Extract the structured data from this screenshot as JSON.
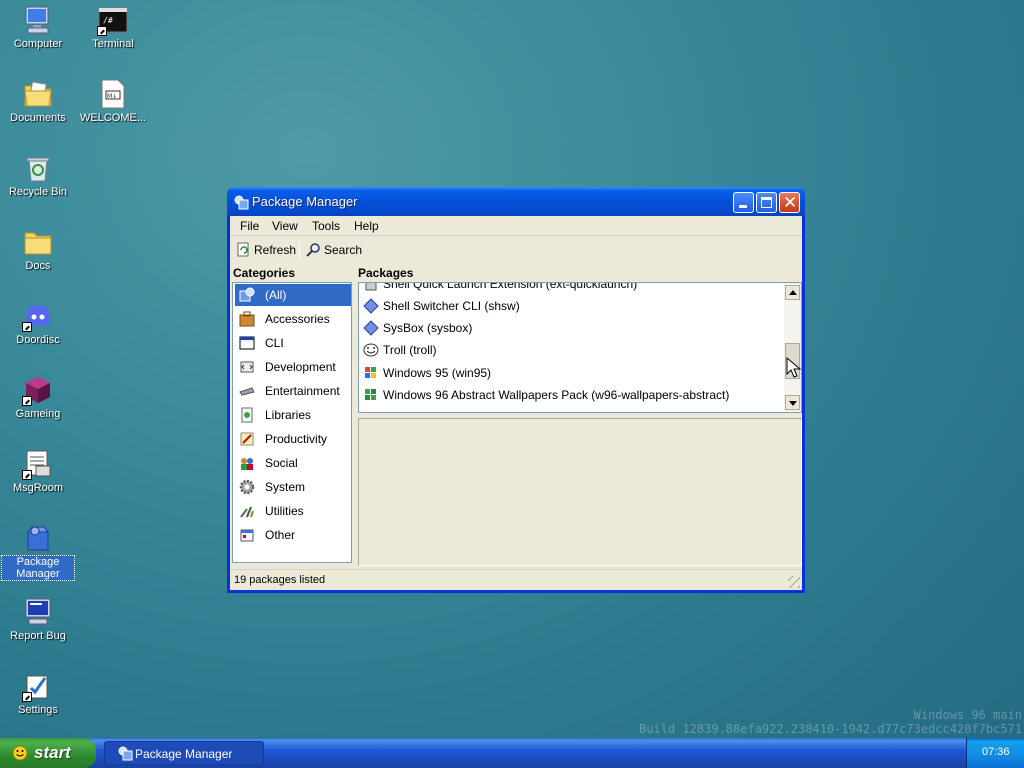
{
  "desktop": {
    "icons": [
      {
        "label": "Computer",
        "icon": "computer-icon"
      },
      {
        "label": "Terminal",
        "icon": "terminal-icon"
      },
      {
        "label": "Documents",
        "icon": "documents-folder-icon"
      },
      {
        "label": "WELCOME...",
        "icon": "markdown-file-icon"
      },
      {
        "label": "Recycle Bin",
        "icon": "recycle-bin-icon"
      },
      {
        "label": "Docs",
        "icon": "folder-icon"
      },
      {
        "label": "Doordisc",
        "icon": "doordisc-icon"
      },
      {
        "label": "Gameing",
        "icon": "game-cube-icon"
      },
      {
        "label": "MsgRoom",
        "icon": "msgroom-icon"
      },
      {
        "label": "Package Manager",
        "icon": "package-manager-icon"
      },
      {
        "label": "Report Bug",
        "icon": "report-bug-icon"
      },
      {
        "label": "Settings",
        "icon": "settings-icon"
      }
    ],
    "watermark": {
      "line1": "Windows 96 main",
      "line2": "Build 12839.88efa922.230410-1942.d77c73edcc428f7bc571"
    }
  },
  "window": {
    "title": "Package Manager",
    "menu": [
      "File",
      "View",
      "Tools",
      "Help"
    ],
    "toolbar": {
      "refresh_label": "Refresh",
      "search_label": "Search"
    },
    "categories_header": "Categories",
    "packages_header": "Packages",
    "categories": [
      {
        "label": "(All)",
        "icon": "all-icon",
        "selected": true
      },
      {
        "label": "Accessories",
        "icon": "accessories-icon"
      },
      {
        "label": "CLI",
        "icon": "cli-icon"
      },
      {
        "label": "Development",
        "icon": "development-icon"
      },
      {
        "label": "Entertainment",
        "icon": "entertainment-icon"
      },
      {
        "label": "Libraries",
        "icon": "libraries-icon"
      },
      {
        "label": "Productivity",
        "icon": "productivity-icon"
      },
      {
        "label": "Social",
        "icon": "social-icon"
      },
      {
        "label": "System",
        "icon": "system-icon"
      },
      {
        "label": "Utilities",
        "icon": "utilities-icon"
      },
      {
        "label": "Other",
        "icon": "other-icon"
      }
    ],
    "packages": [
      {
        "label": "Shell Quick Launch Extension (ext-quicklaunch)",
        "icon": "quicklaunch-icon"
      },
      {
        "label": "Shell Switcher CLI (shsw)",
        "icon": "diamond-icon"
      },
      {
        "label": "SysBox (sysbox)",
        "icon": "diamond-icon"
      },
      {
        "label": "Troll (troll)",
        "icon": "troll-face-icon"
      },
      {
        "label": "Windows 95 (win95)",
        "icon": "windows-flag-icon"
      },
      {
        "label": "Windows 96 Abstract Wallpapers Pack (w96-wallpapers-abstract)",
        "icon": "windows-flag-icon"
      }
    ],
    "status": "19 packages listed"
  },
  "taskbar": {
    "start_label": "start",
    "task_label": "Package Manager",
    "clock": "07:36"
  }
}
